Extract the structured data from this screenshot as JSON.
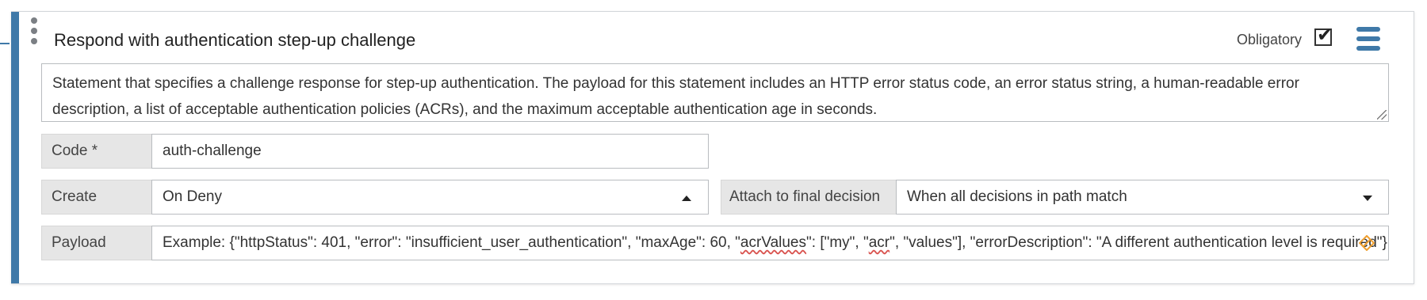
{
  "statement": {
    "title": "Respond with authentication step-up challenge",
    "obligatory_label": "Obligatory",
    "obligatory_checked": true,
    "description": "Statement that specifies a challenge response for step-up authentication. The payload for this statement includes an HTTP error status code, an error status string, a human-readable error description, a list of acceptable authentication policies (ACRs), and the maximum acceptable authentication age in seconds."
  },
  "fields": {
    "code": {
      "label": "Code *",
      "value": "auth-challenge"
    },
    "create": {
      "label": "Create",
      "value": "On Deny"
    },
    "attach": {
      "label": "Attach to final decision",
      "value": "When all decisions in path match"
    },
    "payload": {
      "label": "Payload",
      "parts": [
        "Example: {\"httpStatus\": 401, \"error\": \"insufficient_user_authentication\", \"maxAge\": 60, \"",
        "acrValues",
        "\": [\"my\", \"",
        "acr",
        "\", \"values\"], \"errorDescription\": \"A different authentication level is required\"}"
      ]
    }
  },
  "colors": {
    "accent": "#3f79a8",
    "clear_icon": "#f0a030"
  },
  "icons": [
    "drag-handle-icon",
    "checkbox-check-icon",
    "menu-icon",
    "caret-up-icon",
    "caret-down-icon",
    "clear-diamond-icon"
  ]
}
